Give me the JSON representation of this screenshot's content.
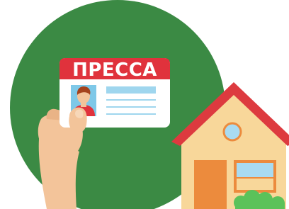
{
  "illustration": {
    "badge": {
      "title": "ПРЕССА"
    }
  },
  "colors": {
    "background_circle": "#3b8a44",
    "badge_header": "#e0323c",
    "badge_body": "#ffffff",
    "badge_lines": "#9fd6ee",
    "photo_frame": "#7ec8e8",
    "skin": "#f3c49a",
    "hair": "#a4421c",
    "house_wall": "#f8d79a",
    "roof": "#dd3a3f",
    "door": "#ec8b3d",
    "window_glass": "#a9dbf1",
    "bush": "#5bc25a"
  }
}
